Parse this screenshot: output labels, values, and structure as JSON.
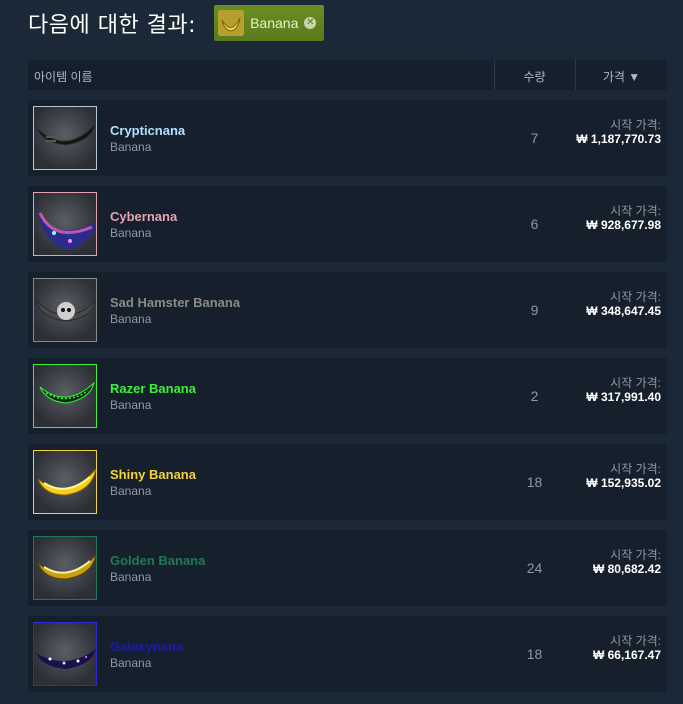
{
  "header": {
    "results_title": "다음에 대한 결과:",
    "filter_tag": {
      "label": "Banana",
      "icon": "banana-icon",
      "close_icon": "close-icon"
    }
  },
  "columns": {
    "name": "아이템 이름",
    "quantity": "수량",
    "price": "가격 ▼"
  },
  "price_label": "시작 가격:",
  "listings": [
    {
      "name": "Crypticnana",
      "game": "Banana",
      "quantity": "7",
      "price": "₩ 1,187,770.73",
      "name_color": "#b0e0ff",
      "border_color": "#b0c8d8"
    },
    {
      "name": "Cybernana",
      "game": "Banana",
      "quantity": "6",
      "price": "₩ 928,677.98",
      "name_color": "#e5a2b4",
      "border_color": "#e5a2b4"
    },
    {
      "name": "Sad Hamster Banana",
      "game": "Banana",
      "quantity": "9",
      "price": "₩ 348,647.45",
      "name_color": "#8a8a8a",
      "border_color": "#8a8a8a"
    },
    {
      "name": "Razer Banana",
      "game": "Banana",
      "quantity": "2",
      "price": "₩ 317,991.40",
      "name_color": "#3cf03c",
      "border_color": "#3cf03c"
    },
    {
      "name": "Shiny Banana",
      "game": "Banana",
      "quantity": "18",
      "price": "₩ 152,935.02",
      "name_color": "#f2d13b",
      "border_color": "#f2d13b"
    },
    {
      "name": "Golden Banana",
      "game": "Banana",
      "quantity": "24",
      "price": "₩ 80,682.42",
      "name_color": "#1f7a55",
      "border_color": "#1f7a55"
    },
    {
      "name": "Galaxynana",
      "game": "Banana",
      "quantity": "18",
      "price": "₩ 66,167.47",
      "name_color": "#1a1aa8",
      "border_color": "#2a2ad0"
    }
  ]
}
